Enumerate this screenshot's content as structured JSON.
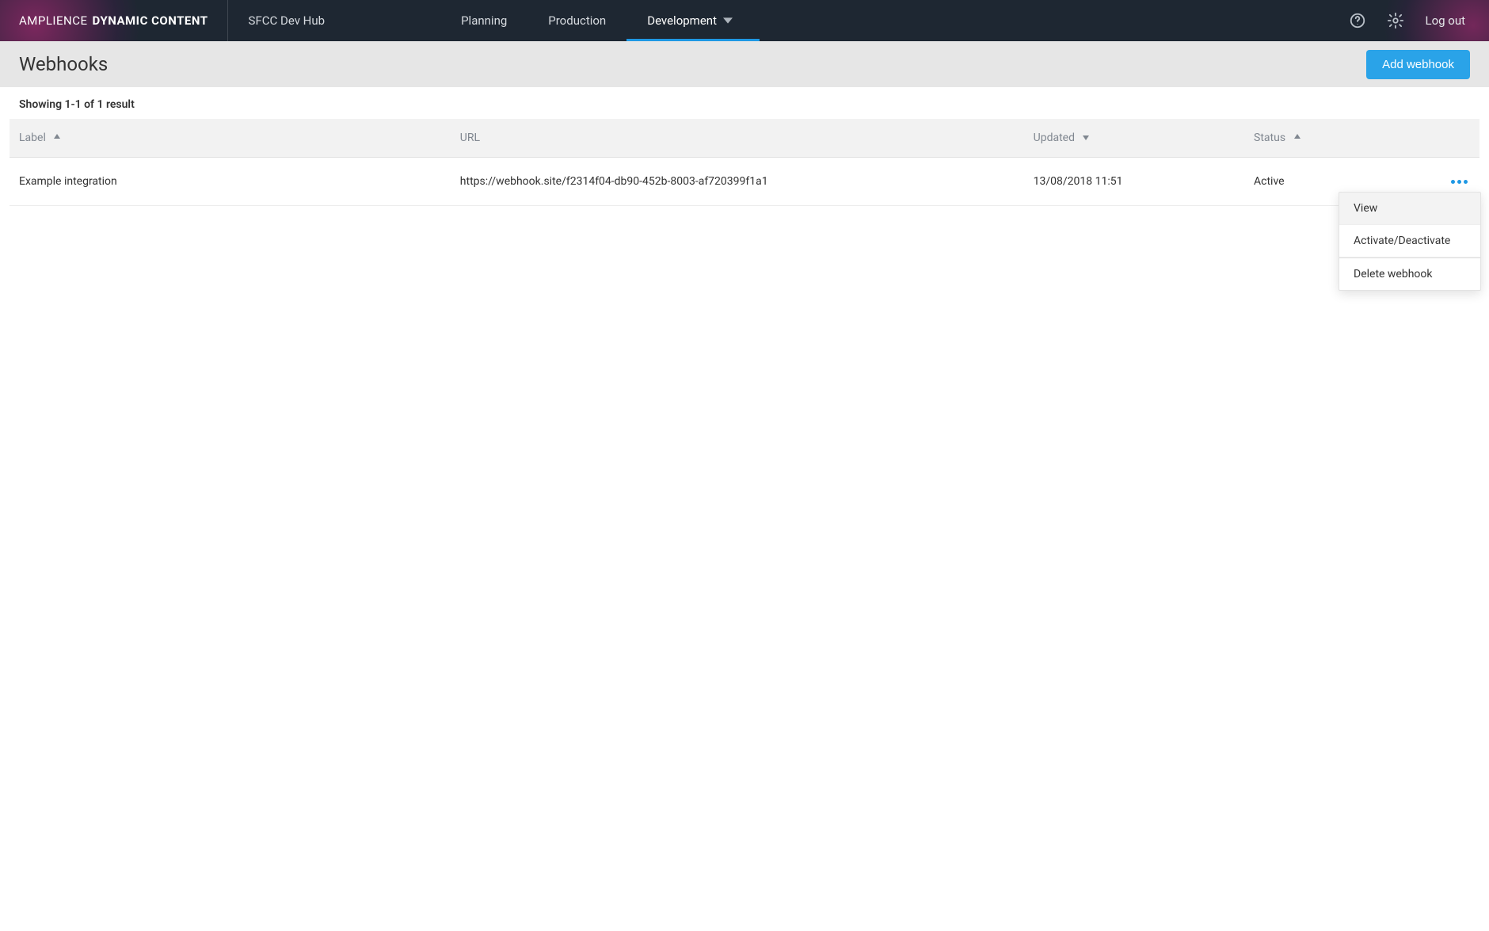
{
  "brand": {
    "light": "AMPLIENCE",
    "bold": "DYNAMIC CONTENT"
  },
  "hub_name": "SFCC Dev Hub",
  "nav": {
    "items": [
      {
        "label": "Planning",
        "active": false
      },
      {
        "label": "Production",
        "active": false
      },
      {
        "label": "Development",
        "active": true
      }
    ]
  },
  "logout_label": "Log out",
  "page": {
    "title": "Webhooks",
    "add_button": "Add webhook",
    "results_summary": "Showing 1-1 of 1 result"
  },
  "table": {
    "columns": {
      "label": "Label",
      "url": "URL",
      "updated": "Updated",
      "status": "Status"
    },
    "rows": [
      {
        "label": "Example integration",
        "url": "https://webhook.site/f2314f04-db90-452b-8003-af720399f1a1",
        "updated": "13/08/2018 11:51",
        "status": "Active"
      }
    ]
  },
  "row_menu": {
    "items": [
      {
        "label": "View",
        "hover": true
      },
      {
        "label": "Activate/Deactivate",
        "hover": false
      },
      {
        "label": "Delete webhook",
        "hover": false
      }
    ]
  },
  "colors": {
    "accent": "#1e98e4"
  }
}
